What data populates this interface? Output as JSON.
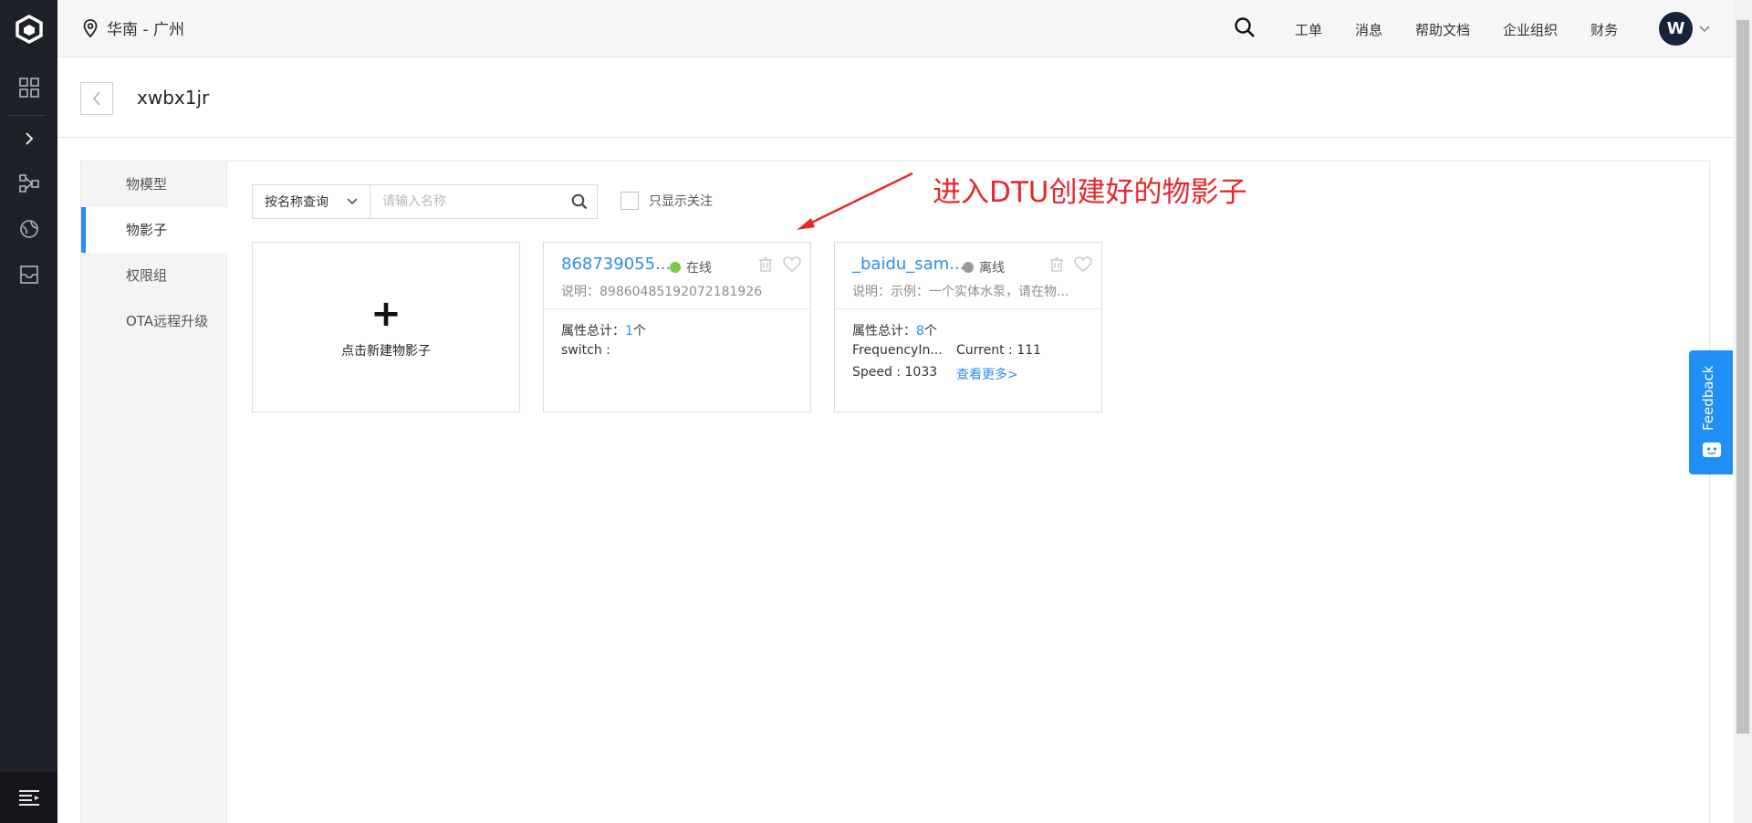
{
  "topbar": {
    "region": "华南 - 广州",
    "nav": [
      "工单",
      "消息",
      "帮助文档",
      "企业组织",
      "财务"
    ],
    "avatar_initial": "W"
  },
  "page": {
    "title": "xwbx1jr"
  },
  "subnav": {
    "items": [
      {
        "label": "物模型",
        "active": false
      },
      {
        "label": "物影子",
        "active": true
      },
      {
        "label": "权限组",
        "active": false
      },
      {
        "label": "OTA远程升级",
        "active": false
      }
    ]
  },
  "toolbar": {
    "select_label": "按名称查询",
    "search_placeholder": "请输入名称",
    "checkbox_label": "只显示关注",
    "checkbox_checked": false
  },
  "annotation": {
    "text": "进入DTU创建好的物影子",
    "color": "#e8262b"
  },
  "new_card": {
    "label": "点击新建物影子"
  },
  "cards": [
    {
      "name": "868739055...",
      "status": "在线",
      "status_color": "#7ac943",
      "desc": "说明：89860485192072181926",
      "total_label": "属性总计：",
      "total_count": "1",
      "total_unit": "个",
      "props": [
        "switch :"
      ],
      "more_link": ""
    },
    {
      "name": "_baidu_sam...",
      "status": "离线",
      "status_color": "#999999",
      "desc": "说明：示例：一个实体水泵，请在物...",
      "total_label": "属性总计：",
      "total_count": "8",
      "total_unit": "个",
      "props": [
        "FrequencyIn...",
        "Current : 111",
        "Speed : 1033"
      ],
      "more_link": "查看更多>"
    }
  ],
  "feedback": {
    "label": "Feedback"
  },
  "colors": {
    "accent": "#2d8cf0",
    "rail": "#1e2128",
    "feedback": "#1f8ff5"
  }
}
